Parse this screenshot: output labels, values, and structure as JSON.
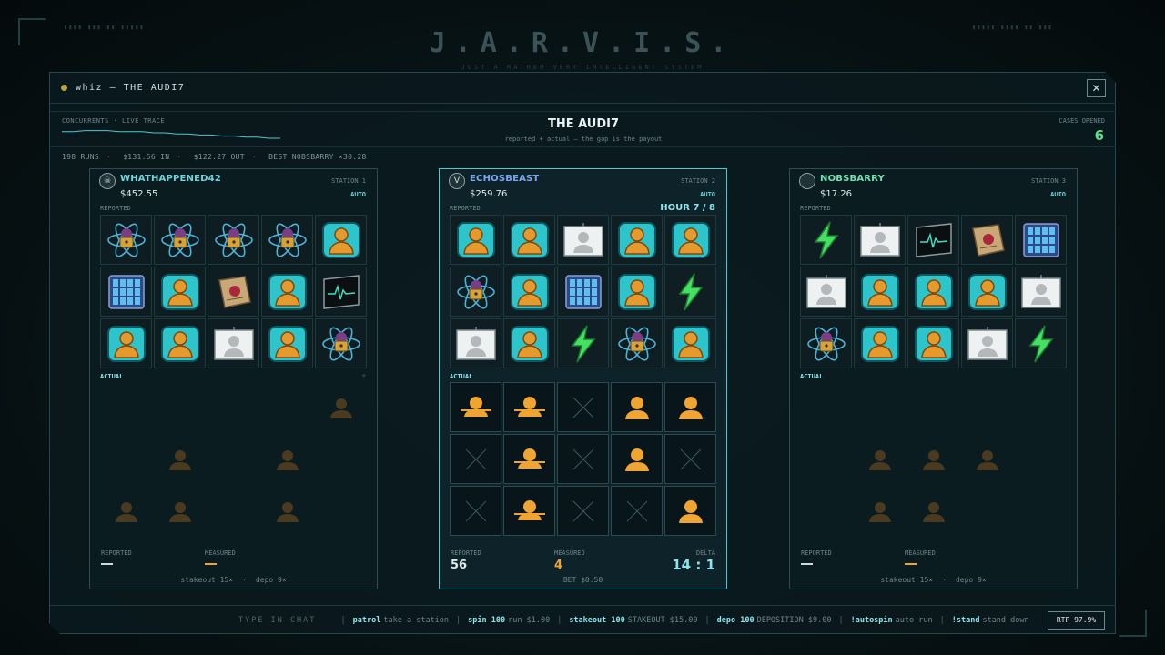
{
  "background": {
    "title": "J.A.R.V.I.S.",
    "subtitle": "JUST A RATHER VERY INTELLIGENT SYSTEM"
  },
  "window": {
    "title": "whiz — THE AUDI7",
    "close_label": "✕"
  },
  "header": {
    "trace_label": "CONCURRENTS · LIVE TRACE",
    "trace_points": [
      4,
      4,
      3,
      3,
      3,
      4,
      4,
      4,
      5,
      5,
      6,
      6,
      7,
      7,
      8,
      8,
      9,
      9,
      10,
      10
    ],
    "title": "THE AUDI7",
    "subtitle": "reported + actual — the gap is the payout",
    "cases_label": "CASES OPENED",
    "cases_value": "6"
  },
  "stats": {
    "runs": "198 RUNS",
    "in": "$131.56 IN",
    "out": "$122.27 OUT",
    "best": "BEST NOBSBARRY ×30.28"
  },
  "panels": [
    {
      "name": "WHATHAPPENED42",
      "name_color": "#6fd4dc",
      "station": "STATION 1",
      "balance": "$452.55",
      "auto": "AUTO",
      "avatar": "☠",
      "reported_label": "REPORTED",
      "hour": "",
      "reported": [
        [
          "atom",
          "atom",
          "atom",
          "atom",
          "person"
        ],
        [
          "server",
          "person",
          "dossier",
          "person",
          "monitor"
        ],
        [
          "person",
          "person",
          "photo",
          "person",
          "atom"
        ]
      ],
      "actual_label": "ACTUAL",
      "actual_mark": "÷",
      "actual": [
        [
          "empty",
          "empty",
          "empty",
          "empty",
          "dim"
        ],
        [
          "empty",
          "dim",
          "empty",
          "dim",
          "empty"
        ],
        [
          "dim",
          "dim",
          "empty",
          "dim",
          "empty"
        ]
      ],
      "reported_stat_label": "REPORTED",
      "reported_stat": "",
      "measured_label": "MEASURED",
      "measured": "",
      "delta_label": "",
      "delta": "",
      "footer_left": "stakeout 15×",
      "footer_right": "depo 9×",
      "footer": ""
    },
    {
      "name": "ECHOSBEAST",
      "name_color": "#7aa6f0",
      "station": "STATION 2",
      "balance": "$259.76",
      "auto": "AUTO",
      "avatar": "V",
      "reported_label": "REPORTED",
      "hour": "HOUR 7 / 8",
      "reported": [
        [
          "person",
          "person",
          "photo",
          "person",
          "person"
        ],
        [
          "atom",
          "person",
          "server",
          "person",
          "bolt"
        ],
        [
          "photo",
          "person",
          "bolt",
          "atom",
          "person"
        ]
      ],
      "actual_label": "ACTUAL",
      "actual_mark": "",
      "actual": [
        [
          "struck",
          "struck",
          "x",
          "orange",
          "orange"
        ],
        [
          "x",
          "struck",
          "x",
          "orange",
          "x"
        ],
        [
          "x",
          "struck",
          "x",
          "x",
          "orange"
        ]
      ],
      "reported_stat_label": "REPORTED",
      "reported_stat": "56",
      "measured_label": "MEASURED",
      "measured": "4",
      "delta_label": "DELTA",
      "delta": "14 : 1",
      "footer_left": "",
      "footer_right": "",
      "footer": "BET $0.50"
    },
    {
      "name": "NOBSBARRY",
      "name_color": "#6fe3b0",
      "station": "STATION 3",
      "balance": "$17.26",
      "auto": "AUTO",
      "avatar": "",
      "reported_label": "REPORTED",
      "hour": "",
      "reported": [
        [
          "bolt",
          "photo",
          "monitor",
          "dossier",
          "server"
        ],
        [
          "photo",
          "person",
          "person",
          "person",
          "photo"
        ],
        [
          "atom",
          "person",
          "person",
          "photo",
          "bolt"
        ]
      ],
      "actual_label": "ACTUAL",
      "actual_mark": "",
      "actual": [
        [
          "empty",
          "empty",
          "empty",
          "empty",
          "empty"
        ],
        [
          "empty",
          "dim",
          "dim",
          "dim",
          "empty"
        ],
        [
          "empty",
          "dim",
          "dim",
          "empty",
          "empty"
        ]
      ],
      "reported_stat_label": "REPORTED",
      "reported_stat": "",
      "measured_label": "MEASURED",
      "measured": "",
      "delta_label": "",
      "delta": "",
      "footer_left": "stakeout 15×",
      "footer_right": "depo 9×",
      "footer": ""
    }
  ],
  "commands": {
    "type_label": "TYPE IN CHAT",
    "items": [
      {
        "key": "patrol",
        "desc": "take a station"
      },
      {
        "key": "spin 100",
        "desc": "run $1.00"
      },
      {
        "key": "stakeout 100",
        "desc": "STAKEOUT $15.00"
      },
      {
        "key": "depo 100",
        "desc": "DEPOSITION $9.00"
      },
      {
        "key": "!autospin",
        "desc": "auto run"
      },
      {
        "key": "!stand",
        "desc": "stand down"
      }
    ],
    "rtp": "RTP 97.9%"
  },
  "colors": {
    "accent": "#4ec9d2",
    "orange": "#f0a431",
    "green": "#5fe08a"
  }
}
